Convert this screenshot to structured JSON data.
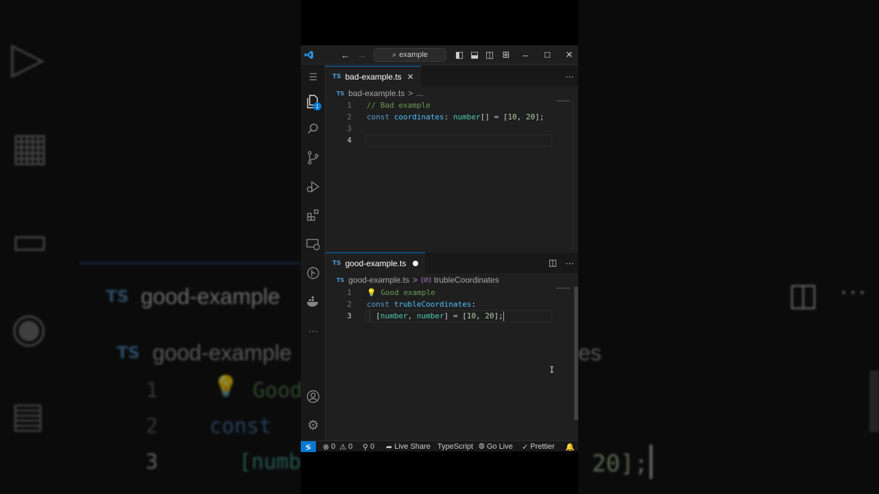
{
  "titlebar": {
    "search_text": "example"
  },
  "activity_bar": {
    "explorer_badge": "1"
  },
  "top_editor": {
    "tab": {
      "lang": "TS",
      "filename": "bad-example.ts"
    },
    "breadcrumb": {
      "lang": "TS",
      "file": "bad-example.ts",
      "sep": ">",
      "rest": "..."
    },
    "lines": [
      {
        "num": "1",
        "tokens": [
          {
            "t": "// Bad example",
            "c": "c-com"
          }
        ]
      },
      {
        "num": "2",
        "tokens": [
          {
            "t": "const ",
            "c": "c-kw"
          },
          {
            "t": "coordinates",
            "c": "c-var"
          },
          {
            "t": ": ",
            "c": "c-pun"
          },
          {
            "t": "number",
            "c": "c-type"
          },
          {
            "t": "[] = [",
            "c": "c-pun"
          },
          {
            "t": "10",
            "c": "c-num"
          },
          {
            "t": ", ",
            "c": "c-pun"
          },
          {
            "t": "20",
            "c": "c-num"
          },
          {
            "t": "];",
            "c": "c-pun"
          }
        ]
      },
      {
        "num": "3",
        "tokens": []
      },
      {
        "num": "4",
        "tokens": []
      }
    ]
  },
  "bottom_editor": {
    "tab": {
      "lang": "TS",
      "filename": "good-example.ts"
    },
    "breadcrumb": {
      "lang": "TS",
      "file": "good-example.ts",
      "sep": ">",
      "symbol": "trubleCoordinates"
    },
    "lines": [
      {
        "num": "1",
        "tokens": [
          {
            "t": "💡",
            "c": "bulb"
          },
          {
            "t": " Good example",
            "c": "c-com"
          }
        ]
      },
      {
        "num": "2",
        "tokens": [
          {
            "t": "const ",
            "c": "c-kw"
          },
          {
            "t": "trubleCoordinates",
            "c": "c-var"
          },
          {
            "t": ":",
            "c": "c-pun"
          }
        ]
      },
      {
        "num": "3",
        "tokens": [
          {
            "t": "  [",
            "c": "c-pun"
          },
          {
            "t": "number",
            "c": "c-type"
          },
          {
            "t": ", ",
            "c": "c-pun"
          },
          {
            "t": "number",
            "c": "c-type"
          },
          {
            "t": "] = [",
            "c": "c-pun"
          },
          {
            "t": "10",
            "c": "c-num"
          },
          {
            "t": ", ",
            "c": "c-pun"
          },
          {
            "t": "20",
            "c": "c-num"
          },
          {
            "t": "];",
            "c": "c-pun"
          }
        ]
      }
    ]
  },
  "statusbar": {
    "errors": "0",
    "warnings": "0",
    "ports": "0",
    "live_share": "Live Share",
    "language": "TypeScript",
    "go_live": "Go Live",
    "prettier": "Prettier"
  },
  "background": {
    "tab_text": "good-example",
    "lang": "TS",
    "crumb_left": "good-example",
    "crumb_right": "es",
    "line1_num": "1",
    "line2_num": "2",
    "line3_num": "3",
    "line1_text": "Good",
    "line2_text": "const",
    "line3_text": "[numb",
    "line3_right": "20];"
  },
  "colors": {
    "accent": "#0078d4",
    "editor_bg": "#1f1f1f",
    "comment": "#6a9955",
    "keyword": "#569cd6",
    "variable": "#4fc1ff",
    "type": "#4ec9b0",
    "number": "#b5cea8"
  }
}
